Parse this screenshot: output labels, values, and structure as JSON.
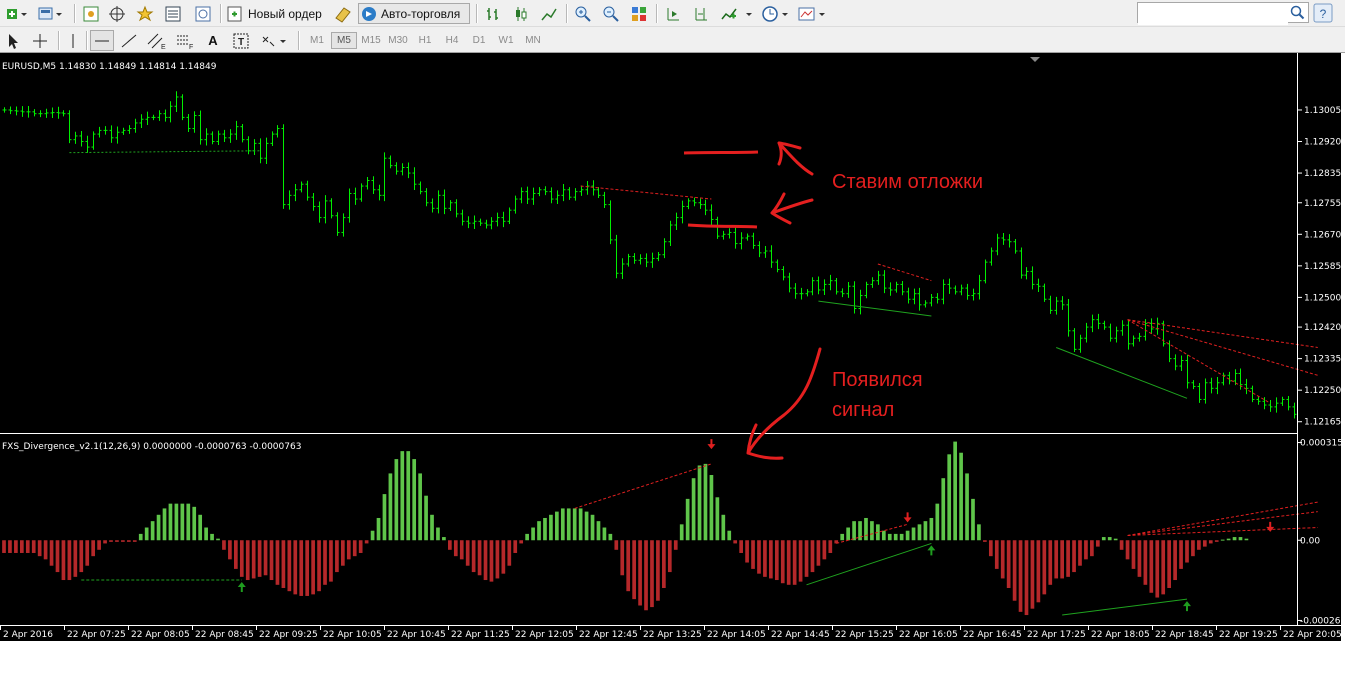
{
  "toolbar": {
    "new_order_label": "Новый ордер",
    "autotrading_label": "Авто-торговля",
    "search_placeholder": "",
    "timeframes": [
      "M1",
      "M5",
      "M15",
      "M30",
      "H1",
      "H4",
      "D1",
      "W1",
      "MN"
    ],
    "active_timeframe": "M5",
    "icons": [
      "new-chart-icon",
      "profiles-icon",
      "market-watch-icon",
      "navigator-icon",
      "favorites-icon",
      "data-window-icon",
      "strategy-tester-icon",
      "new-order-icon",
      "metaeditor-icon",
      "autotrading-icon",
      "bar-chart-icon",
      "candles-icon",
      "line-chart-icon",
      "zoom-in-icon",
      "zoom-out-icon",
      "tile-windows-icon",
      "autoscroll-icon",
      "chart-shift-icon",
      "indicators-icon",
      "periods-icon",
      "templates-icon",
      "cursor-icon",
      "crosshair-icon",
      "vertical-line-icon",
      "horizontal-line-icon",
      "trendline-icon",
      "equidistant-channel-icon",
      "fibonacci-icon",
      "text-icon",
      "text-label-icon",
      "arrows-icon",
      "search-icon",
      "help-icon"
    ]
  },
  "main_chart": {
    "header": "EURUSD,M5  1.14830 1.14849 1.14814 1.14849",
    "price_labels": [
      "1.13005",
      "1.12920",
      "1.12835",
      "1.12755",
      "1.12670",
      "1.12585",
      "1.12500",
      "1.12420",
      "1.12335",
      "1.12250",
      "1.12165"
    ],
    "annotation_top": "Ставим отложки",
    "annotation_bottom_line1": "Появился",
    "annotation_bottom_line2": "сигнал"
  },
  "indicator": {
    "header": "FXS_Divergence_v2.1(12,26,9) 0.0000000 -0.0000763 -0.0000763",
    "scale_labels": [
      "0.000315",
      "0.00",
      "-0.000260"
    ]
  },
  "time_axis": [
    "2 Apr 2016",
    "22 Apr 07:25",
    "22 Apr 08:05",
    "22 Apr 08:45",
    "22 Apr 09:25",
    "22 Apr 10:05",
    "22 Apr 10:45",
    "22 Apr 11:25",
    "22 Apr 12:05",
    "22 Apr 12:45",
    "22 Apr 13:25",
    "22 Apr 14:05",
    "22 Apr 14:45",
    "22 Apr 15:25",
    "22 Apr 16:05",
    "22 Apr 16:45",
    "22 Apr 17:25",
    "22 Apr 18:05",
    "22 Apr 18:45",
    "22 Apr 19:25",
    "22 Apr 20:05"
  ],
  "chart_data": {
    "type": "bar",
    "symbol": "EURUSD",
    "timeframe": "M5",
    "price_ylim": [
      1.1214,
      1.1311
    ],
    "close_prices": [
      1.13005,
      1.13003,
      1.13002,
      1.13,
      1.13,
      1.12995,
      1.12995,
      1.12997,
      1.12998,
      1.12997,
      1.12995,
      1.12925,
      1.12935,
      1.1292,
      1.12905,
      1.1294,
      1.1295,
      1.1295,
      1.1293,
      1.12945,
      1.1295,
      1.12955,
      1.1297,
      1.1298,
      1.12985,
      1.12985,
      1.12995,
      1.12985,
      1.13015,
      1.1304,
      1.12985,
      1.12955,
      1.1299,
      1.12925,
      1.1294,
      1.1292,
      1.1294,
      1.1293,
      1.1294,
      1.1296,
      1.12925,
      1.12895,
      1.12915,
      1.12875,
      1.12915,
      1.1294,
      1.12955,
      1.1275,
      1.12775,
      1.1279,
      1.12805,
      1.1277,
      1.12745,
      1.12715,
      1.1276,
      1.1272,
      1.12675,
      1.12715,
      1.1278,
      1.12765,
      1.128,
      1.12815,
      1.1279,
      1.12775,
      1.12875,
      1.12855,
      1.1284,
      1.1285,
      1.12835,
      1.12805,
      1.12785,
      1.12755,
      1.1274,
      1.12775,
      1.1274,
      1.12755,
      1.12725,
      1.12705,
      1.127,
      1.12705,
      1.127,
      1.12695,
      1.12705,
      1.12715,
      1.12705,
      1.12735,
      1.12765,
      1.12785,
      1.12765,
      1.1278,
      1.1279,
      1.12785,
      1.12765,
      1.12775,
      1.1279,
      1.1277,
      1.12785,
      1.1279,
      1.128,
      1.1279,
      1.12775,
      1.1275,
      1.12655,
      1.12565,
      1.1259,
      1.1261,
      1.126,
      1.12605,
      1.12595,
      1.12605,
      1.12615,
      1.1265,
      1.12695,
      1.12715,
      1.12745,
      1.1276,
      1.12755,
      1.1275,
      1.12735,
      1.1271,
      1.12665,
      1.1267,
      1.12675,
      1.12645,
      1.1266,
      1.12665,
      1.1264,
      1.1262,
      1.12625,
      1.12595,
      1.12575,
      1.12555,
      1.12525,
      1.1251,
      1.1251,
      1.12515,
      1.12545,
      1.1252,
      1.12535,
      1.12545,
      1.12515,
      1.1251,
      1.1253,
      1.1247,
      1.12505,
      1.12535,
      1.12545,
      1.1256,
      1.12525,
      1.1252,
      1.12535,
      1.12515,
      1.12495,
      1.1251,
      1.1248,
      1.12485,
      1.125,
      1.12495,
      1.12535,
      1.12525,
      1.12515,
      1.12525,
      1.12505,
      1.1251,
      1.12545,
      1.12595,
      1.12625,
      1.1266,
      1.12655,
      1.1265,
      1.12625,
      1.1256,
      1.1257,
      1.12535,
      1.1253,
      1.12495,
      1.12465,
      1.1249,
      1.1248,
      1.1241,
      1.1236,
      1.1239,
      1.1242,
      1.1244,
      1.1243,
      1.1242,
      1.1239,
      1.1241,
      1.12425,
      1.12375,
      1.1239,
      1.12395,
      1.1243,
      1.12415,
      1.1243,
      1.12375,
      1.12335,
      1.12315,
      1.1233,
      1.1227,
      1.1226,
      1.12225,
      1.1227,
      1.12255,
      1.1227,
      1.1229,
      1.12275,
      1.12295,
      1.12265,
      1.12255,
      1.12225,
      1.1222,
      1.1221,
      1.12205,
      1.12215,
      1.12225,
      1.12205,
      1.12185
    ],
    "macd_ylim": [
      -0.00026,
      0.000315
    ],
    "macd_values": [
      -4e-05,
      -4e-05,
      -4e-05,
      -4e-05,
      -4e-05,
      -4e-05,
      -5e-05,
      -6e-05,
      -8e-05,
      -0.0001,
      -0.000125,
      -0.000125,
      -0.000115,
      -0.0001,
      -8e-05,
      -5e-05,
      -3e-05,
      -1e-05,
      -5e-06,
      -5e-06,
      -5e-06,
      -5e-06,
      -5e-06,
      2e-05,
      4e-05,
      6e-05,
      8e-05,
      0.0001,
      0.000115,
      0.000115,
      0.000115,
      0.000115,
      0.000105,
      8e-05,
      4e-05,
      2e-05,
      5e-06,
      -3e-05,
      -6e-05,
      -9e-05,
      -0.000115,
      -0.000125,
      -0.00012,
      -0.000115,
      -0.00011,
      -0.000125,
      -0.00014,
      -0.00015,
      -0.00016,
      -0.00017,
      -0.000175,
      -0.000175,
      -0.00017,
      -0.00016,
      -0.00014,
      -0.00013,
      -0.0001,
      -8e-05,
      -6e-05,
      -5e-05,
      -4e-05,
      -1e-05,
      3e-05,
      7e-05,
      0.000145,
      0.00021,
      0.000255,
      0.00028,
      0.00028,
      0.000255,
      0.00021,
      0.00014,
      8e-05,
      4e-05,
      1e-05,
      -3e-05,
      -5e-05,
      -6e-05,
      -8e-05,
      -0.0001,
      -0.00011,
      -0.000125,
      -0.00013,
      -0.00012,
      -0.000105,
      -8e-05,
      -4e-05,
      -1e-05,
      2e-05,
      4e-05,
      6e-05,
      7e-05,
      8e-05,
      9e-05,
      0.0001,
      0.0001,
      0.0001,
      0.0001,
      9e-05,
      8e-05,
      6e-05,
      4e-05,
      2e-05,
      -3e-05,
      -0.00011,
      -0.00016,
      -0.000185,
      -0.000205,
      -0.00022,
      -0.00021,
      -0.00019,
      -0.00015,
      -0.0001,
      -3e-05,
      5e-05,
      0.00013,
      0.000195,
      0.000235,
      0.00024,
      0.000205,
      0.000135,
      8e-05,
      3e-05,
      -1e-05,
      -4e-05,
      -7e-05,
      -9e-05,
      -0.000105,
      -0.000115,
      -0.00012,
      -0.000125,
      -0.000135,
      -0.00014,
      -0.00014,
      -0.00013,
      -0.000115,
      -0.0001,
      -8e-05,
      -6e-05,
      -4e-05,
      -1e-05,
      2e-05,
      4e-05,
      6e-05,
      6e-05,
      7e-05,
      6e-05,
      5e-05,
      3e-05,
      2e-05,
      2e-05,
      2e-05,
      3e-05,
      4e-05,
      5e-05,
      6e-05,
      7e-05,
      0.000115,
      0.000195,
      0.00027,
      0.00031,
      0.000275,
      0.00021,
      0.00013,
      5e-05,
      -5e-06,
      -5e-05,
      -9e-05,
      -0.00012,
      -0.00015,
      -0.00019,
      -0.000225,
      -0.000235,
      -0.000215,
      -0.000195,
      -0.00017,
      -0.00014,
      -0.00012,
      -0.00012,
      -0.000115,
      -0.0001,
      -8e-05,
      -6e-05,
      -5e-05,
      -2e-05,
      1e-05,
      1e-05,
      5e-06,
      -3e-05,
      -6e-05,
      -9e-05,
      -0.000115,
      -0.00014,
      -0.000165,
      -0.00018,
      -0.00017,
      -0.00015,
      -0.000125,
      -9e-05,
      -7e-05,
      -5e-05,
      -3e-05,
      -2e-05,
      -1e-05,
      -5e-06,
      2e-06,
      5e-06,
      1e-05,
      1e-05,
      5e-06
    ]
  }
}
